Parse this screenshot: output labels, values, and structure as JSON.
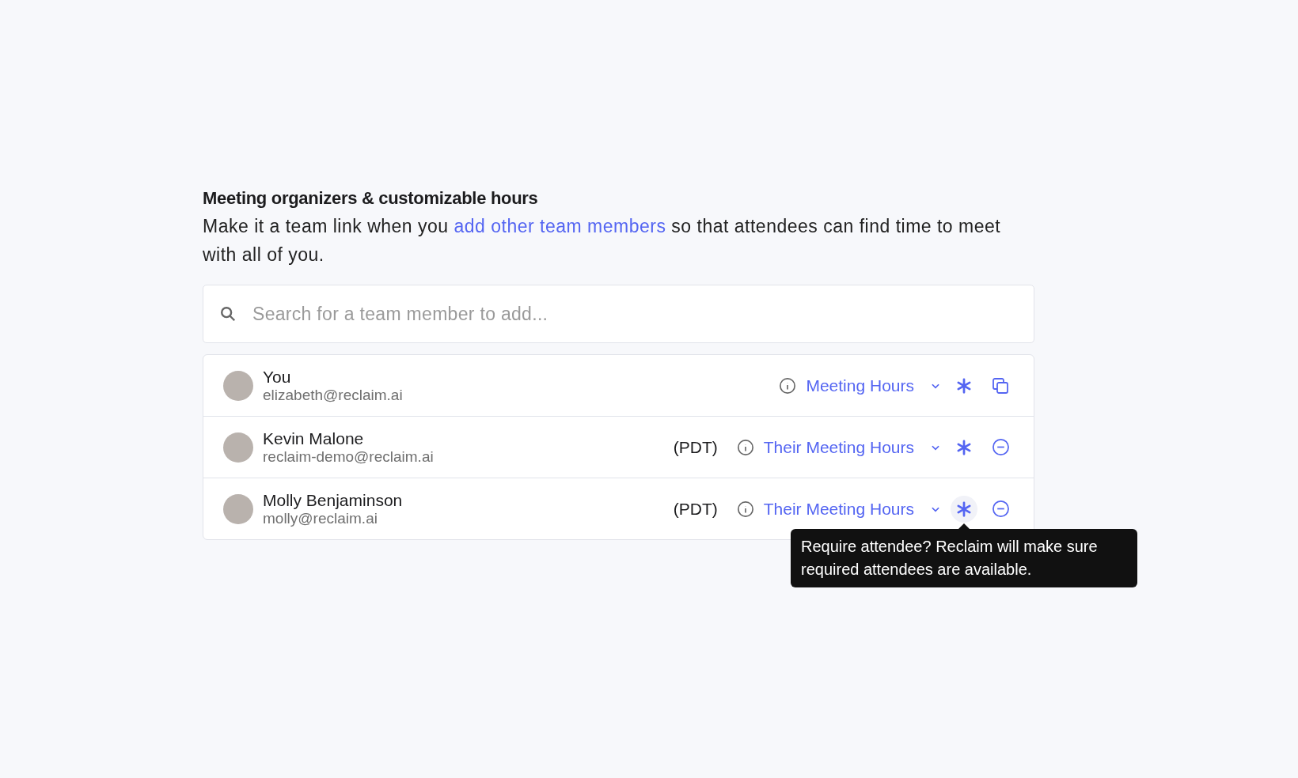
{
  "section": {
    "title": "Meeting organizers & customizable hours",
    "description_before": "Make it a team link when you ",
    "description_link": "add other team members",
    "description_after": " so that attendees can find time to meet with all of you."
  },
  "search": {
    "placeholder": "Search for a team member to add..."
  },
  "members": [
    {
      "name": "You",
      "email": "elizabeth@reclaim.ai",
      "hours": "Meeting Hours",
      "kind": "copy",
      "required_hovered": false
    },
    {
      "name": "Kevin Malone",
      "email": "reclaim-demo@reclaim.ai",
      "timezone": "(PDT)",
      "hours": "Their Meeting Hours",
      "kind": "remove",
      "required_hovered": false
    },
    {
      "name": "Molly Benjaminson",
      "email": "molly@reclaim.ai",
      "timezone": "(PDT)",
      "hours": "Their Meeting Hours",
      "kind": "remove",
      "required_hovered": true,
      "tooltip": "Require attendee? Reclaim will make sure required attendees are available."
    }
  ]
}
